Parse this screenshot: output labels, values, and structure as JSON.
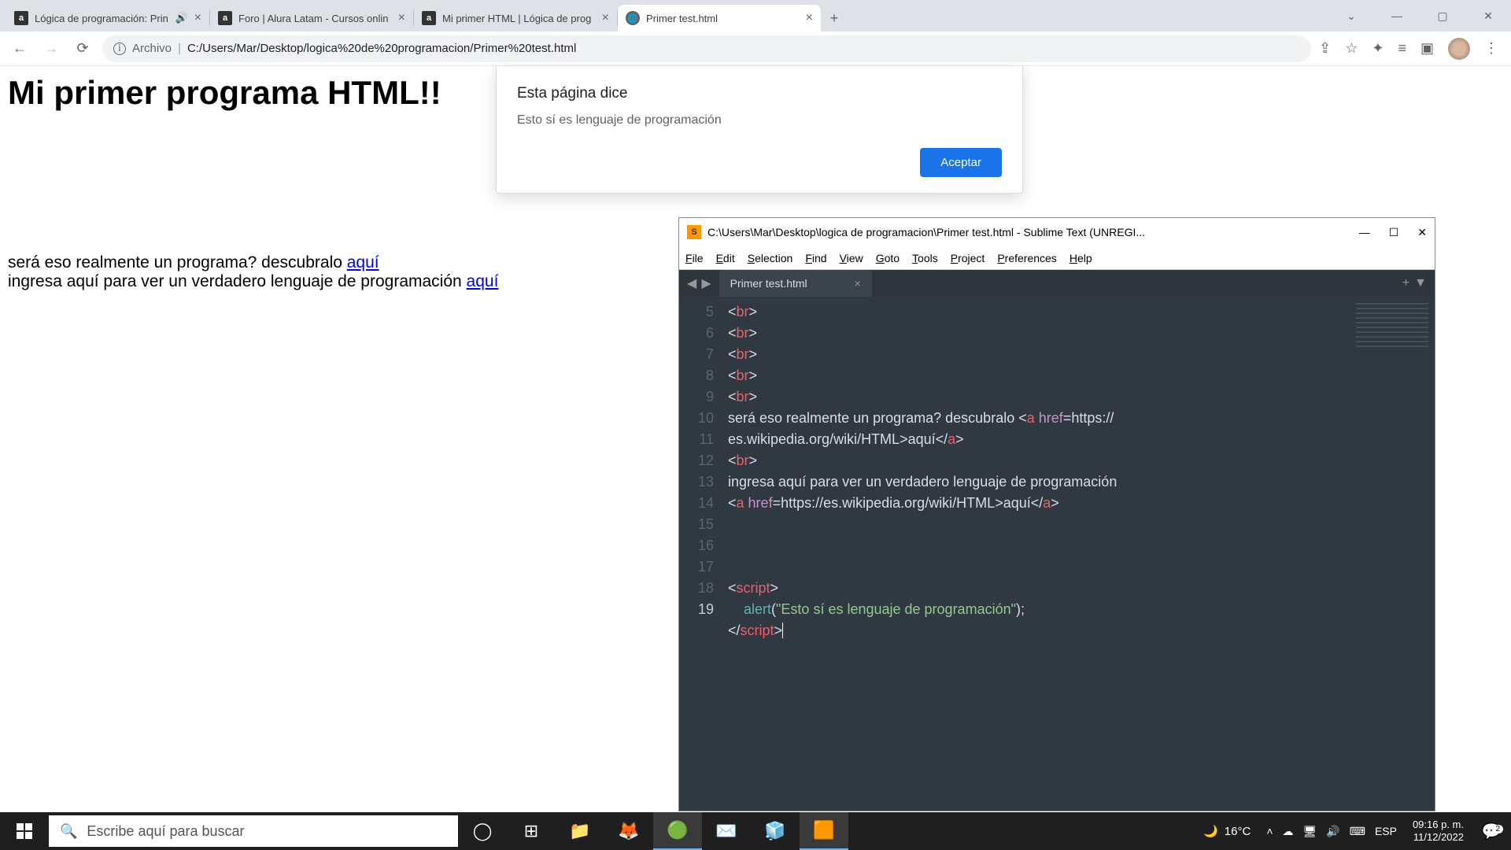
{
  "browser": {
    "tabs": [
      {
        "title": "Lógica de programación: Prin",
        "audio": true
      },
      {
        "title": "Foro | Alura Latam - Cursos onlin"
      },
      {
        "title": "Mi primer HTML | Lógica de prog"
      },
      {
        "title": "Primer test.html",
        "active": true,
        "globe": true
      }
    ],
    "address_label": "Archivo",
    "address_path": "C:/Users/Mar/Desktop/logica%20de%20programacion/Primer%20test.html"
  },
  "page": {
    "heading": "Mi primer programa HTML!!",
    "line1_text": "será eso realmente un programa? descubralo ",
    "line1_link": "aquí",
    "line2_text": "ingresa aquí para ver un verdadero lenguaje de programación ",
    "line2_link": "aquí"
  },
  "dialog": {
    "title": "Esta página dice",
    "message": "Esto sí es lenguaje de programación",
    "ok": "Aceptar"
  },
  "sublime": {
    "title": "C:\\Users\\Mar\\Desktop\\logica de programacion\\Primer test.html - Sublime Text (UNREGI...",
    "menu": [
      "File",
      "Edit",
      "Selection",
      "Find",
      "View",
      "Goto",
      "Tools",
      "Project",
      "Preferences",
      "Help"
    ],
    "tab": "Primer test.html",
    "lines": [
      "5",
      "6",
      "7",
      "8",
      "9",
      "10",
      "11",
      "12",
      "13",
      "14",
      "15",
      "16",
      "17",
      "18",
      "19"
    ],
    "code": {
      "l10a": "será eso realmente un programa? descubralo ",
      "l10b": "https://",
      "l10c": "es.wikipedia.org/wiki/HTML",
      "l10d": "aquí",
      "l12a": "ingresa aquí para ver un verdadero lenguaje de programación",
      "l12b": "https://es.wikipedia.org/wiki/HTML",
      "l12c": "aquí",
      "alert_str": "\"Esto sí es lenguaje de programación\""
    }
  },
  "taskbar": {
    "search_placeholder": "Escribe aquí para buscar",
    "temp": "16°C",
    "lang": "ESP",
    "time": "09:16 p. m.",
    "date": "11/12/2022",
    "notif_count": "2"
  }
}
